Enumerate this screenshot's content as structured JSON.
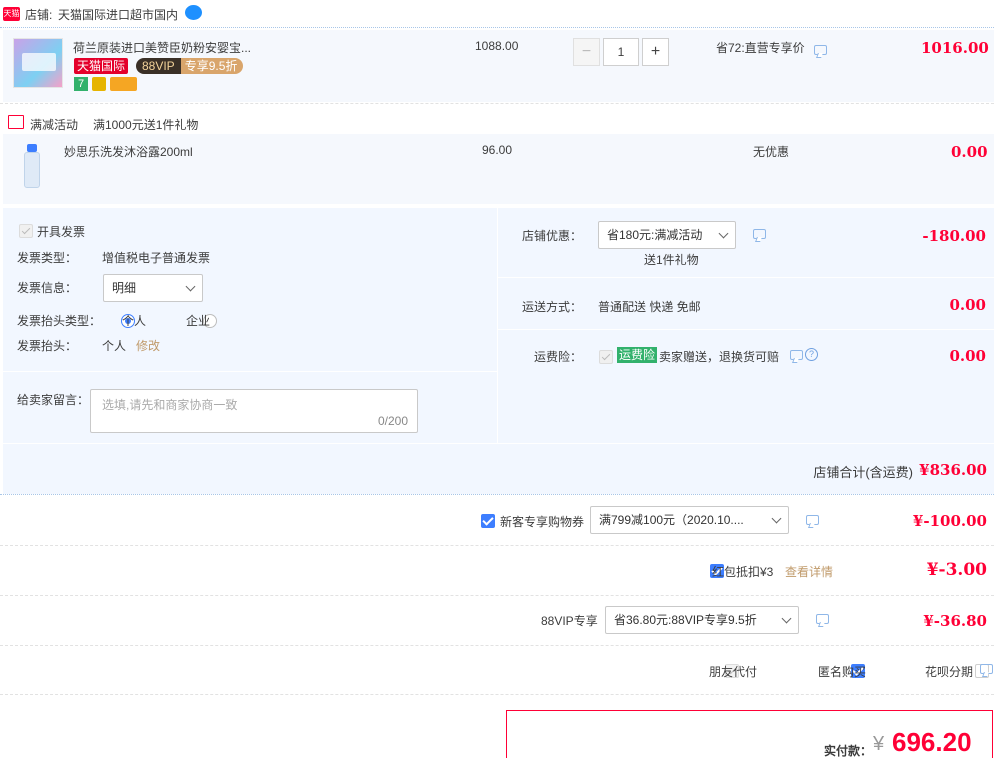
{
  "shop": {
    "badge": "天猫",
    "label": "店铺:",
    "name": "天猫国际进口超市国内"
  },
  "item1": {
    "title": "荷兰原装进口美赞臣奶粉安婴宝...",
    "tag_tmall": "天猫国际",
    "tag_88vip": "88VIP",
    "tag_discount": "专享9.5折",
    "badge_seven": "7",
    "unit_price": "1088.00",
    "qty": "1",
    "qty_minus": "−",
    "qty_plus": "+",
    "promo": "省72:直营专享价",
    "total": "1016.00"
  },
  "activity": {
    "label": "满减活动",
    "desc": "满1000元送1件礼物"
  },
  "item2": {
    "title": "妙思乐洗发沐浴露200ml",
    "unit_price": "96.00",
    "promo": "无优惠",
    "total": "0.00"
  },
  "invoice": {
    "open_label": "开具发票",
    "type_label": "发票类型：",
    "type_value": "增值税电子普通发票",
    "info_label": "发票信息：",
    "info_value": "明细",
    "header_type_label": "发票抬头类型：",
    "opt_personal": "个人",
    "opt_company": "企业",
    "header_label": "发票抬头：",
    "header_value": "个人",
    "edit": "修改"
  },
  "message": {
    "label": "给卖家留言：",
    "placeholder": "选填,请先和商家协商一致",
    "counter": "0/200"
  },
  "store_discount": {
    "label": "店铺优惠：",
    "value": "省180元:满减活动",
    "sub": "送1件礼物",
    "amount": "-180.00"
  },
  "shipping": {
    "label": "运送方式：",
    "value": "普通配送 快递 免邮",
    "amount": "0.00"
  },
  "insurance": {
    "label": "运费险：",
    "tag": "运费险",
    "desc": "卖家赠送，退换货可赔",
    "help": "?",
    "amount": "0.00"
  },
  "shop_total": {
    "label": "店铺合计(含运费)",
    "amount": "¥836.00"
  },
  "coupon": {
    "label": "新客专享购物券",
    "value": "满799减100元（2020.10....",
    "amount": "¥-100.00"
  },
  "redpacket": {
    "label": "红包抵扣¥3",
    "link": "查看详情",
    "amount": "¥-3.00"
  },
  "vip": {
    "label": "88VIP专享",
    "value": "省36.80元:88VIP专享9.5折",
    "amount": "¥-36.80"
  },
  "options": {
    "friend_pay": "朋友代付",
    "anonymous": "匿名购买",
    "huabei": "花呗分期"
  },
  "final": {
    "label": "实付款：",
    "currency": "¥",
    "amount": "696.20"
  },
  "colors": {
    "accent_red": "#ff0036",
    "brand_blue": "#3d7eff",
    "panel_bg": "#f2f7ff"
  }
}
